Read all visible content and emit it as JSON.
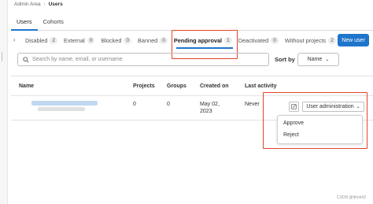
{
  "breadcrumb": {
    "parent": "Admin Area",
    "current": "Users"
  },
  "top_tabs": [
    {
      "label": "Users"
    },
    {
      "label": "Cohorts"
    }
  ],
  "filter_tabs": [
    {
      "label": "Disabled",
      "count": "2"
    },
    {
      "label": "External",
      "count": "0"
    },
    {
      "label": "Blocked",
      "count": "0"
    },
    {
      "label": "Banned",
      "count": "0"
    },
    {
      "label": "Pending approval",
      "count": "1"
    },
    {
      "label": "Deactivated",
      "count": "0"
    },
    {
      "label": "Without projects",
      "count": "2"
    }
  ],
  "new_user_label": "New user",
  "search": {
    "placeholder": "Search by name, email, or username"
  },
  "sort": {
    "label": "Sort by",
    "value": "Name"
  },
  "table": {
    "headers": {
      "name": "Name",
      "projects": "Projects",
      "groups": "Groups",
      "created": "Created on",
      "activity": "Last activity"
    },
    "row": {
      "projects": "0",
      "groups": "0",
      "created_line1": "May 02,",
      "created_line2": "2023",
      "activity": "Never"
    }
  },
  "actions": {
    "user_admin_label": "User administration",
    "approve_label": "Approve",
    "reject_label": "Reject"
  },
  "watermark": "CSDN @ithnk43",
  "colors": {
    "primary": "#1f75cb",
    "highlight": "#e24329"
  }
}
